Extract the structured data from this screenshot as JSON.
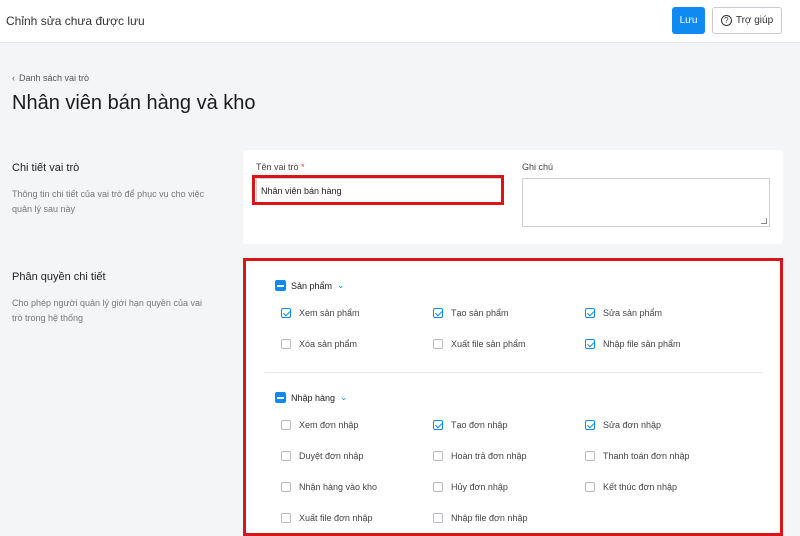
{
  "header": {
    "status_text": "Chỉnh sửa chưa được lưu",
    "save_label": "Lưu",
    "help_label": "Trợ giúp"
  },
  "breadcrumb": {
    "back_label": "Danh sách vai trò"
  },
  "page_title": "Nhân viên bán hàng và kho",
  "role_details": {
    "title": "Chi tiết vai trò",
    "description": "Thông tin chi tiết của vai trò để phục vụ cho việc quản lý sau này",
    "role_name_label": "Tên vai trò",
    "role_name_required": "*",
    "role_name_value": "Nhân viên bán hàng",
    "note_label": "Ghi chú",
    "note_value": ""
  },
  "permissions": {
    "title": "Phân quyền chi tiết",
    "description": "Cho phép người quản lý giới hạn quyền của vai trò trong hệ thống",
    "groups": [
      {
        "label": "Sản phẩm",
        "items": [
          {
            "label": "Xem sản phẩm",
            "checked": true
          },
          {
            "label": "Tạo sản phẩm",
            "checked": true
          },
          {
            "label": "Sửa sản phẩm",
            "checked": true
          },
          {
            "label": "Xóa sản phẩm",
            "checked": false
          },
          {
            "label": "Xuất file sản phẩm",
            "checked": false
          },
          {
            "label": "Nhập file sản phẩm",
            "checked": true
          }
        ]
      },
      {
        "label": "Nhập hàng",
        "items": [
          {
            "label": "Xem đơn nhập",
            "checked": false
          },
          {
            "label": "Tạo đơn nhập",
            "checked": true
          },
          {
            "label": "Sửa đơn nhập",
            "checked": true
          },
          {
            "label": "Duyệt đơn nhập",
            "checked": false
          },
          {
            "label": "Hoàn trả đơn nhập",
            "checked": false
          },
          {
            "label": "Thanh toán đơn nhập",
            "checked": false
          },
          {
            "label": "Nhận hàng vào kho",
            "checked": false
          },
          {
            "label": "Hủy đơn nhập",
            "checked": false
          },
          {
            "label": "Kết thúc đơn nhập",
            "checked": false
          },
          {
            "label": "Xuất file đơn nhập",
            "checked": false
          },
          {
            "label": "Nhập file đơn nhập",
            "checked": false
          }
        ]
      }
    ]
  },
  "colors": {
    "accent": "#0e8af0",
    "highlight": "#d9151b"
  }
}
